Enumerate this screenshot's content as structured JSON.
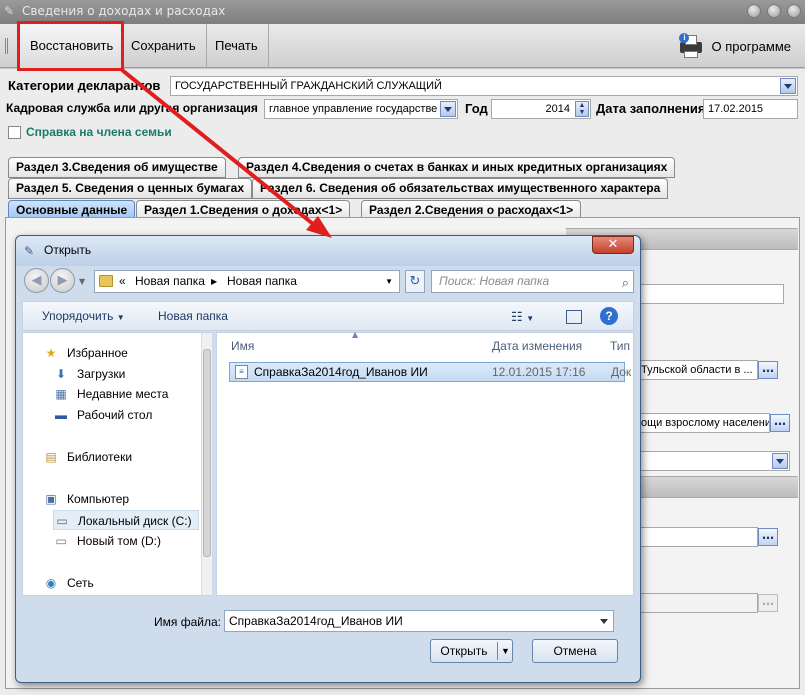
{
  "window": {
    "title": "Сведения о доходах и расходах"
  },
  "toolbar": {
    "restore": "Восстановить",
    "save": "Сохранить",
    "print": "Печать",
    "about": "О программе"
  },
  "form": {
    "declarant_label": "Категории декларантов",
    "declarant_value": "ГОСУДАРСТВЕННЫЙ ГРАЖДАНСКИЙ СЛУЖАЩИЙ",
    "hr_label": "Кадровая служба или другая организация",
    "hr_value": "главное управление государстве",
    "year_label": "Год",
    "year_value": "2014",
    "date_label": "Дата заполнения",
    "date_value": "17.02.2015",
    "family_label": "Справка на члена семьи"
  },
  "tabs": {
    "row1": [
      "Раздел 3.Сведения об имуществе",
      "Раздел 4.Сведения о счетах в банках и иных кредитных организациях"
    ],
    "row2": [
      "Раздел 5. Сведения о ценных бумагах",
      "Раздел 6. Сведения об обязательствах имущественного характера"
    ],
    "row3": [
      "Основные данные",
      "Раздел 1.Сведения о доходах<1>",
      "Раздел 2.Сведения о расходах<1>"
    ]
  },
  "background_fields": {
    "org_value": "Тульской области в ...",
    "position_value": "ощи взрослому населени"
  },
  "dialog": {
    "title": "Открыть",
    "path": [
      "Новая папка",
      "Новая папка"
    ],
    "search_placeholder": "Поиск: Новая папка",
    "organize": "Упорядочить",
    "new_folder": "Новая папка",
    "tree": [
      {
        "label": "Избранное",
        "icon": "star-icon"
      },
      {
        "label": "Загрузки",
        "icon": "downloads-icon"
      },
      {
        "label": "Недавние места",
        "icon": "recent-places-icon"
      },
      {
        "label": "Рабочий стол",
        "icon": "desktop-icon"
      },
      {
        "label": "Библиотеки",
        "icon": "libraries-icon"
      },
      {
        "label": "Компьютер",
        "icon": "computer-icon"
      },
      {
        "label": "Локальный диск (C:)",
        "icon": "hard-disk-icon"
      },
      {
        "label": "Новый том (D:)",
        "icon": "drive-icon"
      },
      {
        "label": "Сеть",
        "icon": "network-icon"
      }
    ],
    "columns": {
      "name": "Имя",
      "date": "Дата изменения",
      "type": "Тип"
    },
    "files": [
      {
        "name": "СправкаЗа2014год_Иванов ИИ",
        "date": "12.01.2015 17:16",
        "type": "Док"
      }
    ],
    "filename_label": "Имя файла:",
    "filename_value": "СправкаЗа2014год_Иванов ИИ",
    "open": "Открыть",
    "cancel": "Отмена"
  },
  "colors": {
    "highlight": "#e01e1e",
    "tab_active": "#9dc2ee"
  }
}
